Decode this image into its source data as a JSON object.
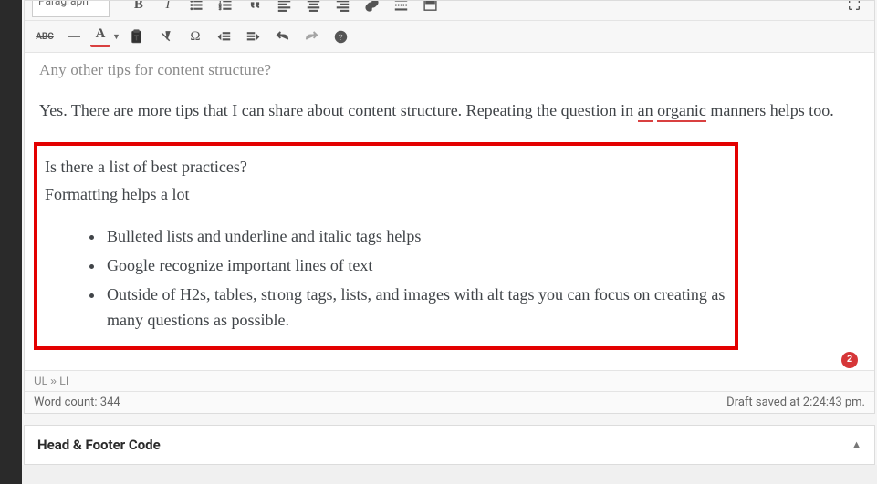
{
  "toolbar": {
    "format_label": "Paragraph",
    "bold_label": "B",
    "italic_label": "I",
    "strike_label": "ABC",
    "textcolor_label": "A",
    "omega_label": "Ω"
  },
  "content": {
    "cutoff_heading": "Any other tips for content structure?",
    "para1_before": "Yes. There are more tips that I can share about content structure. Repeating the question in ",
    "para1_u1": "an",
    "para1_mid": " ",
    "para1_u2": "organic",
    "para1_after": " manners helps too.",
    "hl_line1": "Is there a list of best practices?",
    "hl_line2": "Formatting helps a lot",
    "bullets": [
      "Bulleted lists and underline and italic tags helps",
      "Google recognize important lines of text",
      "Outside of H2s, tables, strong tags, lists, and images with alt tags you can focus on creating as many questions as possible."
    ]
  },
  "status": {
    "breadcrumb": "UL » LI",
    "wordcount_label": "Word count: 344",
    "saved_label": "Draft saved at 2:24:43 pm."
  },
  "badge_count": "2",
  "panel": {
    "title": "Head & Footer Code"
  }
}
